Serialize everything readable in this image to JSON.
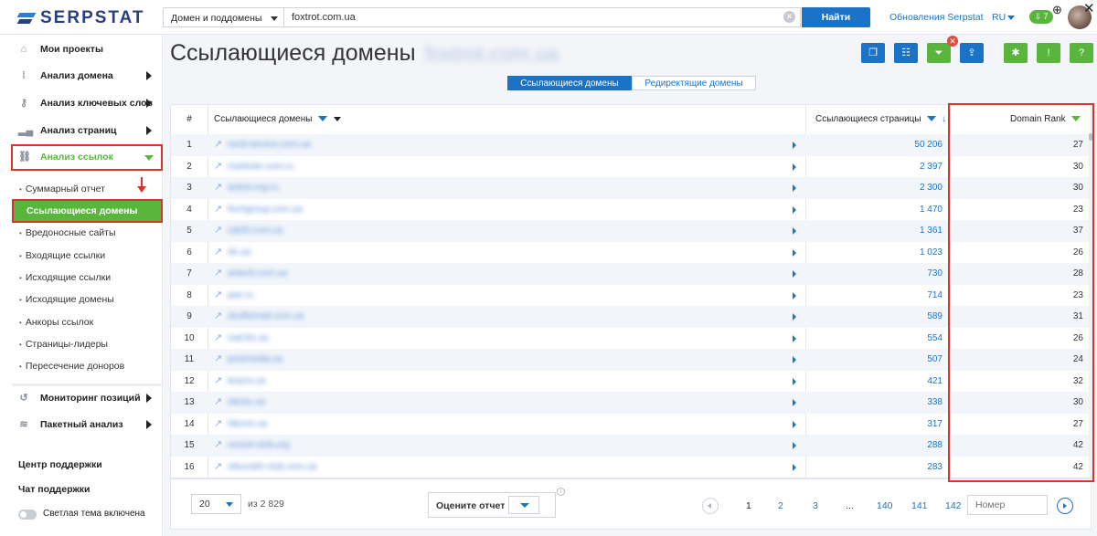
{
  "brand": {
    "name": "SERPSTAT"
  },
  "search": {
    "scope": "Домен и поддомены",
    "query": "foxtrot.com.ua",
    "find_label": "Найти"
  },
  "topbar": {
    "updates": "Обновления Serpstat",
    "lang": "RU",
    "downloads": "7"
  },
  "sidebar": {
    "items": [
      {
        "label": "Мои проекты",
        "icon": "home-icon"
      },
      {
        "label": "Анализ домена",
        "icon": "domain-analysis-icon"
      },
      {
        "label": "Анализ ключевых слов",
        "icon": "key-icon"
      },
      {
        "label": "Анализ страниц",
        "icon": "bar-chart-icon"
      },
      {
        "label": "Анализ ссылок",
        "icon": "link-icon"
      }
    ],
    "sub_items": [
      "Суммарный отчет",
      "Ссылающиеся домены",
      "Вредоносные сайты",
      "Входящие ссылки",
      "Исходящие ссылки",
      "Исходящие домены",
      "Анкоры ссылок",
      "Страницы-лидеры",
      "Пересечение доноров"
    ],
    "lower_items": [
      {
        "label": "Мониторинг позиций",
        "icon": "history-icon"
      },
      {
        "label": "Пакетный анализ",
        "icon": "database-icon"
      }
    ],
    "footer": [
      "Центр поддержки",
      "Чат поддержки"
    ],
    "theme_label": "Светлая тема включена"
  },
  "page": {
    "title": "Ссылающиеся домены",
    "title_domain": "foxtrot.com.ua",
    "tabs": [
      "Ссылающиеся домены",
      "Редиректящие домены"
    ]
  },
  "toolbar": {
    "icons": [
      "copy-icon",
      "columns-icon",
      "filter-icon",
      "export-icon",
      "bug-icon",
      "feedback-icon",
      "help-icon"
    ]
  },
  "table": {
    "headers": {
      "num": "#",
      "domain": "Ссылающиеся домены",
      "pages": "Ссылающиеся страницы",
      "rank": "Domain Rank"
    },
    "rows": [
      {
        "n": "1",
        "domain": "nerd-service.com.ua",
        "pages": "50 206",
        "rank": "27"
      },
      {
        "n": "2",
        "domain": "marketer.com.ru",
        "pages": "2 397",
        "rank": "30"
      },
      {
        "n": "3",
        "domain": "antivir.org.ru",
        "pages": "2 300",
        "rank": "30"
      },
      {
        "n": "4",
        "domain": "fischgroup.com.ua",
        "pages": "1 470",
        "rank": "23"
      },
      {
        "n": "5",
        "domain": "cat20.com.ua",
        "pages": "1 361",
        "rank": "37"
      },
      {
        "n": "6",
        "domain": "3e.ua",
        "pages": "1 023",
        "rank": "26"
      },
      {
        "n": "7",
        "domain": "antecti.com.ua",
        "pages": "730",
        "rank": "28"
      },
      {
        "n": "8",
        "domain": "pao.ru",
        "pages": "714",
        "rank": "23"
      },
      {
        "n": "9",
        "domain": "skuffsinrait.com.ua",
        "pages": "589",
        "rank": "31"
      },
      {
        "n": "10",
        "domain": "real.kh.ua",
        "pages": "554",
        "rank": "26"
      },
      {
        "n": "11",
        "domain": "postmedia.ua",
        "pages": "507",
        "rank": "24"
      },
      {
        "n": "12",
        "domain": "bravni.ua",
        "pages": "421",
        "rank": "32"
      },
      {
        "n": "13",
        "domain": "electo.ua",
        "pages": "338",
        "rank": "30"
      },
      {
        "n": "14",
        "domain": "hikmm.ua",
        "pages": "317",
        "rank": "27"
      },
      {
        "n": "15",
        "domain": "vessel-club.org",
        "pages": "288",
        "rank": "42"
      },
      {
        "n": "16",
        "domain": "otkuvokh-club.com.ua",
        "pages": "283",
        "rank": "42"
      }
    ]
  },
  "pager": {
    "per_page": "20",
    "of_total": "из 2 829",
    "rate_label": "Оцените отчет",
    "pages": [
      "1",
      "2",
      "3",
      "...",
      "140",
      "141",
      "142"
    ],
    "page_input_placeholder": "Номер"
  }
}
